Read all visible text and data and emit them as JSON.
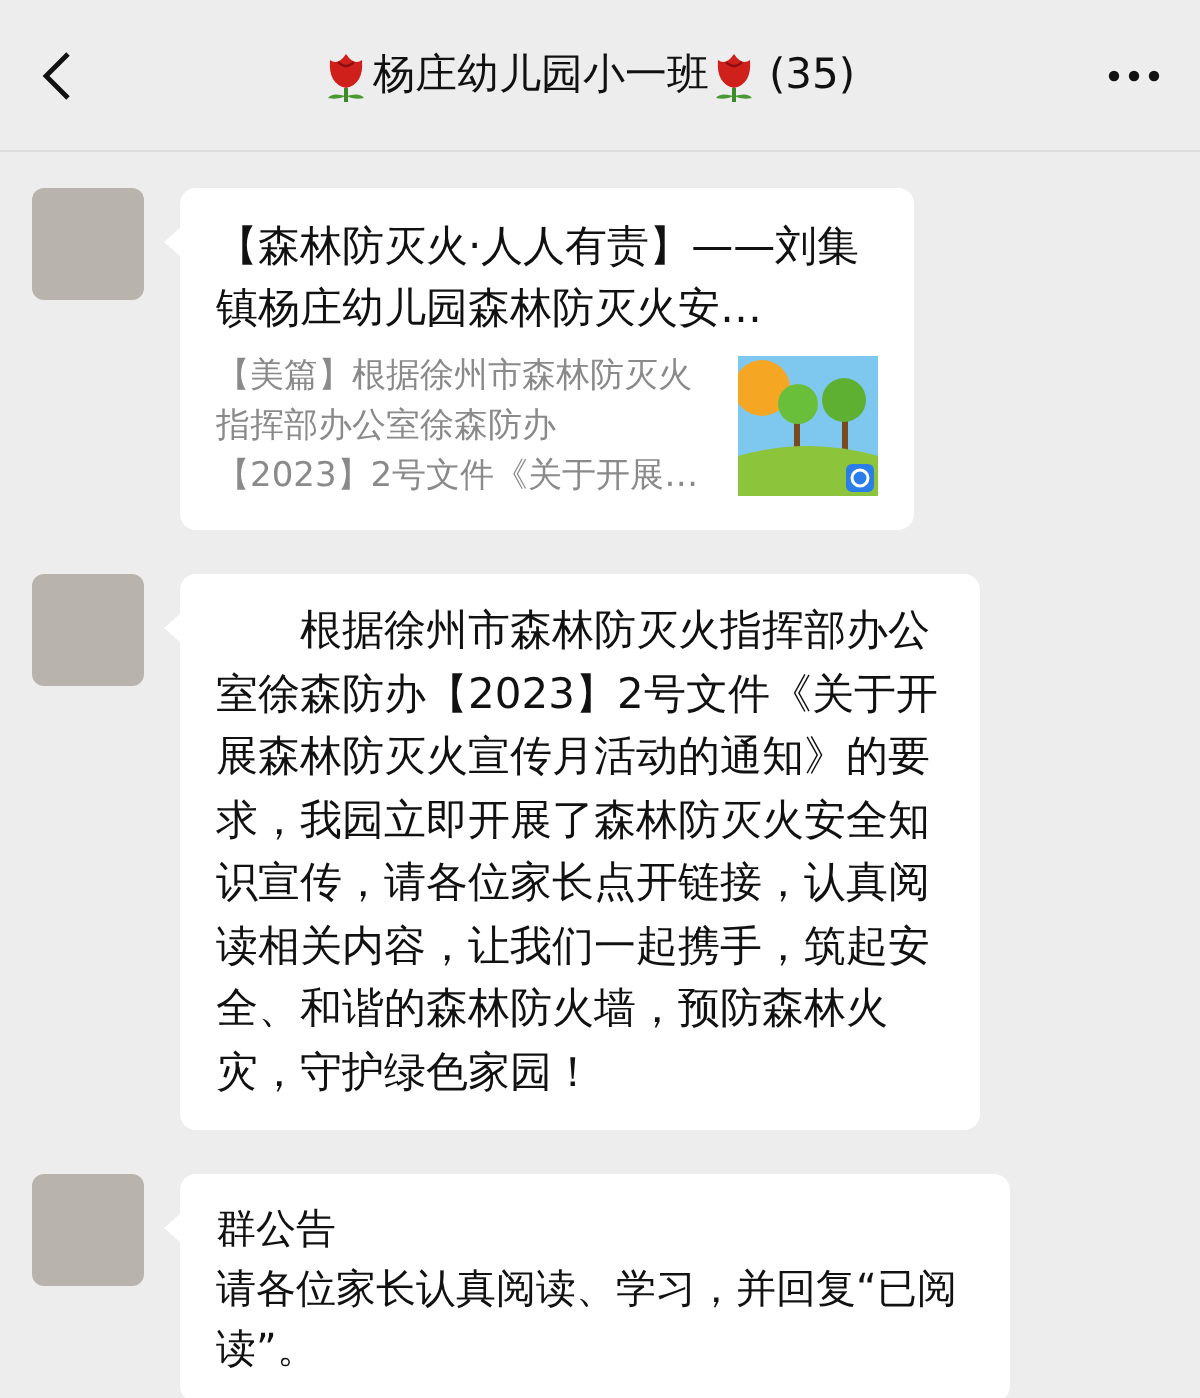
{
  "header": {
    "title": "杨庄幼儿园小一班",
    "count": "(35)"
  },
  "messages": [
    {
      "kind": "link",
      "title": "【森林防灭火·人人有责】——刘集镇杨庄幼儿园森林防灭火安…",
      "description": "【美篇】根据徐州市森林防灭火指挥部办公室徐森防办【2023】2号文件《关于开展…"
    },
    {
      "kind": "text",
      "text": "根据徐州市森林防灭火指挥部办公室徐森防办【2023】2号文件《关于开展森林防灭火宣传月活动的通知》的要求，我园立即开展了森林防灭火安全知识宣传，请各位家长点开链接，认真阅读相关内容，让我们一起携手，筑起安全、和谐的森林防火墙，预防森林火灾，守护绿色家园！"
    },
    {
      "kind": "notice",
      "title": "群公告",
      "text": "请各位家长认真阅读、学习，并回复“已阅读”。"
    }
  ]
}
